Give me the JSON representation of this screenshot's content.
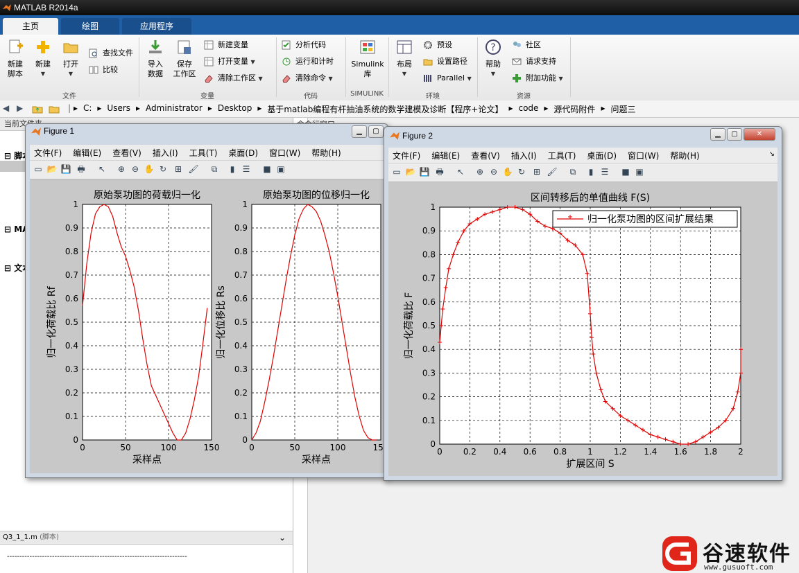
{
  "app": {
    "title": "MATLAB R2014a"
  },
  "ribbon": {
    "tabs": [
      "主页",
      "绘图",
      "应用程序"
    ],
    "file_group": {
      "new_script": "新建\n脚本",
      "new": "新建",
      "open": "打开",
      "find_files": "查找文件",
      "compare": "比较",
      "label": "文件"
    },
    "variable_group": {
      "import": "导入\n数据",
      "save_ws": "保存\n工作区",
      "new_var": "新建变量",
      "open_var": "打开变量",
      "clear_ws": "清除工作区",
      "label": "变量"
    },
    "code_group": {
      "analyze": "分析代码",
      "run_time": "运行和计时",
      "clear_cmd": "清除命令",
      "label": "代码"
    },
    "simulink_group": {
      "simulink": "Simulink\n库",
      "label": "SIMULINK"
    },
    "env_group": {
      "layout": "布局",
      "prefs": "预设",
      "set_path": "设置路径",
      "parallel": "Parallel",
      "label": "环境"
    },
    "res_group": {
      "help": "帮助",
      "community": "社区",
      "support": "请求支持",
      "addons": "附加功能",
      "label": "资源"
    }
  },
  "address": {
    "crumbs": [
      "C:",
      "Users",
      "Administrator",
      "Desktop",
      "基于matlab编程有杆抽油系统的数学建模及诊断【程序+论文】",
      "code",
      "源代码附件",
      "问题三"
    ]
  },
  "left": {
    "current_folder": "当前文件夹",
    "section1": "脚本",
    "section2": "MA",
    "section3": "文本",
    "details_file": "Q3_1_1.m",
    "details_type": "(脚本)",
    "details_line": "------------------------------------------------------------------------",
    "cmd_window": "命令行窗口"
  },
  "menus": [
    "文件(F)",
    "编辑(E)",
    "查看(V)",
    "插入(I)",
    "工具(T)",
    "桌面(D)",
    "窗口(W)",
    "帮助(H)"
  ],
  "fig1": {
    "title": "Figure 1",
    "plots": [
      {
        "title": "原始泵功图的荷载归一化",
        "xlabel": "采样点",
        "ylabel": "归一化荷载比 Rf"
      },
      {
        "title": "原始泵功图的位移归一化",
        "xlabel": "采样点",
        "ylabel": "归一化位移比 Rs"
      }
    ]
  },
  "fig2": {
    "title": "Figure 2",
    "plot": {
      "title": "区间转移后的单值曲线 F(S)",
      "xlabel": "扩展区间 S",
      "ylabel": "归一化荷载比 F",
      "legend": "归一化泵功图的区间扩展结果"
    }
  },
  "watermark": {
    "brand": "谷速软件",
    "url": "www.gusuoft.com"
  },
  "colors": {
    "ribbon_blue": "#1f5fa6",
    "line_red": "#e00000"
  },
  "chart_data": [
    {
      "type": "line",
      "title": "原始泵功图的荷载归一化",
      "xlabel": "采样点",
      "ylabel": "归一化荷载比 Rf",
      "xlim": [
        0,
        150
      ],
      "ylim": [
        0,
        1
      ],
      "xticks": [
        0,
        50,
        100,
        150
      ],
      "yticks": [
        0,
        0.1,
        0.2,
        0.3,
        0.4,
        0.5,
        0.6,
        0.7,
        0.8,
        0.9,
        1
      ],
      "grid": true,
      "series": [
        {
          "x": [
            0,
            5,
            10,
            15,
            20,
            25,
            30,
            35,
            40,
            45,
            50,
            55,
            60,
            65,
            70,
            75,
            80,
            85,
            90,
            95,
            100,
            105,
            110,
            115,
            120,
            125,
            130,
            135,
            140,
            145
          ],
          "values": [
            0.57,
            0.75,
            0.88,
            0.96,
            0.99,
            1.0,
            0.99,
            0.95,
            0.88,
            0.82,
            0.78,
            0.72,
            0.65,
            0.55,
            0.43,
            0.32,
            0.23,
            0.19,
            0.15,
            0.11,
            0.07,
            0.03,
            0.0,
            0.0,
            0.03,
            0.09,
            0.17,
            0.27,
            0.41,
            0.56
          ]
        }
      ]
    },
    {
      "type": "line",
      "title": "原始泵功图的位移归一化",
      "xlabel": "采样点",
      "ylabel": "归一化位移比 Rs",
      "xlim": [
        0,
        150
      ],
      "ylim": [
        0,
        1
      ],
      "xticks": [
        0,
        50,
        100,
        150
      ],
      "yticks": [
        0,
        0.1,
        0.2,
        0.3,
        0.4,
        0.5,
        0.6,
        0.7,
        0.8,
        0.9,
        1
      ],
      "grid": true,
      "series": [
        {
          "x": [
            0,
            5,
            10,
            15,
            20,
            25,
            30,
            35,
            40,
            45,
            50,
            55,
            60,
            65,
            70,
            75,
            80,
            85,
            90,
            95,
            100,
            105,
            110,
            115,
            120,
            125,
            130,
            135,
            140,
            145
          ],
          "values": [
            0.0,
            0.03,
            0.08,
            0.16,
            0.25,
            0.35,
            0.46,
            0.57,
            0.68,
            0.78,
            0.87,
            0.94,
            0.98,
            1.0,
            0.99,
            0.97,
            0.93,
            0.87,
            0.8,
            0.71,
            0.61,
            0.5,
            0.39,
            0.28,
            0.18,
            0.1,
            0.04,
            0.01,
            0.0,
            0.0
          ]
        }
      ]
    },
    {
      "type": "line",
      "title": "区间转移后的单值曲线 F(S)",
      "xlabel": "扩展区间 S",
      "ylabel": "归一化荷载比 F",
      "xlim": [
        0,
        2
      ],
      "ylim": [
        0,
        1
      ],
      "xticks": [
        0,
        0.2,
        0.4,
        0.6,
        0.8,
        1,
        1.2,
        1.4,
        1.6,
        1.8,
        2
      ],
      "yticks": [
        0,
        0.1,
        0.2,
        0.3,
        0.4,
        0.5,
        0.6,
        0.7,
        0.8,
        0.9,
        1
      ],
      "grid": true,
      "legend_position": "top-right",
      "series": [
        {
          "name": "归一化泵功图的区间扩展结果",
          "x": [
            0.0,
            0.01,
            0.02,
            0.04,
            0.06,
            0.09,
            0.12,
            0.16,
            0.2,
            0.25,
            0.3,
            0.35,
            0.4,
            0.45,
            0.5,
            0.55,
            0.6,
            0.65,
            0.7,
            0.75,
            0.8,
            0.85,
            0.9,
            0.95,
            0.98,
            1.0,
            1.01,
            1.02,
            1.04,
            1.07,
            1.1,
            1.15,
            1.2,
            1.25,
            1.3,
            1.35,
            1.4,
            1.45,
            1.5,
            1.55,
            1.6,
            1.65,
            1.7,
            1.75,
            1.8,
            1.85,
            1.9,
            1.95,
            1.98,
            2.0,
            2.0
          ],
          "values": [
            0.43,
            0.5,
            0.57,
            0.66,
            0.74,
            0.8,
            0.85,
            0.9,
            0.93,
            0.95,
            0.97,
            0.98,
            0.99,
            1.0,
            1.0,
            0.99,
            0.97,
            0.94,
            0.92,
            0.91,
            0.89,
            0.86,
            0.84,
            0.8,
            0.72,
            0.55,
            0.45,
            0.38,
            0.3,
            0.23,
            0.18,
            0.15,
            0.12,
            0.1,
            0.08,
            0.06,
            0.04,
            0.03,
            0.02,
            0.01,
            0.0,
            0.0,
            0.01,
            0.03,
            0.05,
            0.07,
            0.1,
            0.15,
            0.22,
            0.3,
            0.4
          ]
        }
      ]
    }
  ]
}
